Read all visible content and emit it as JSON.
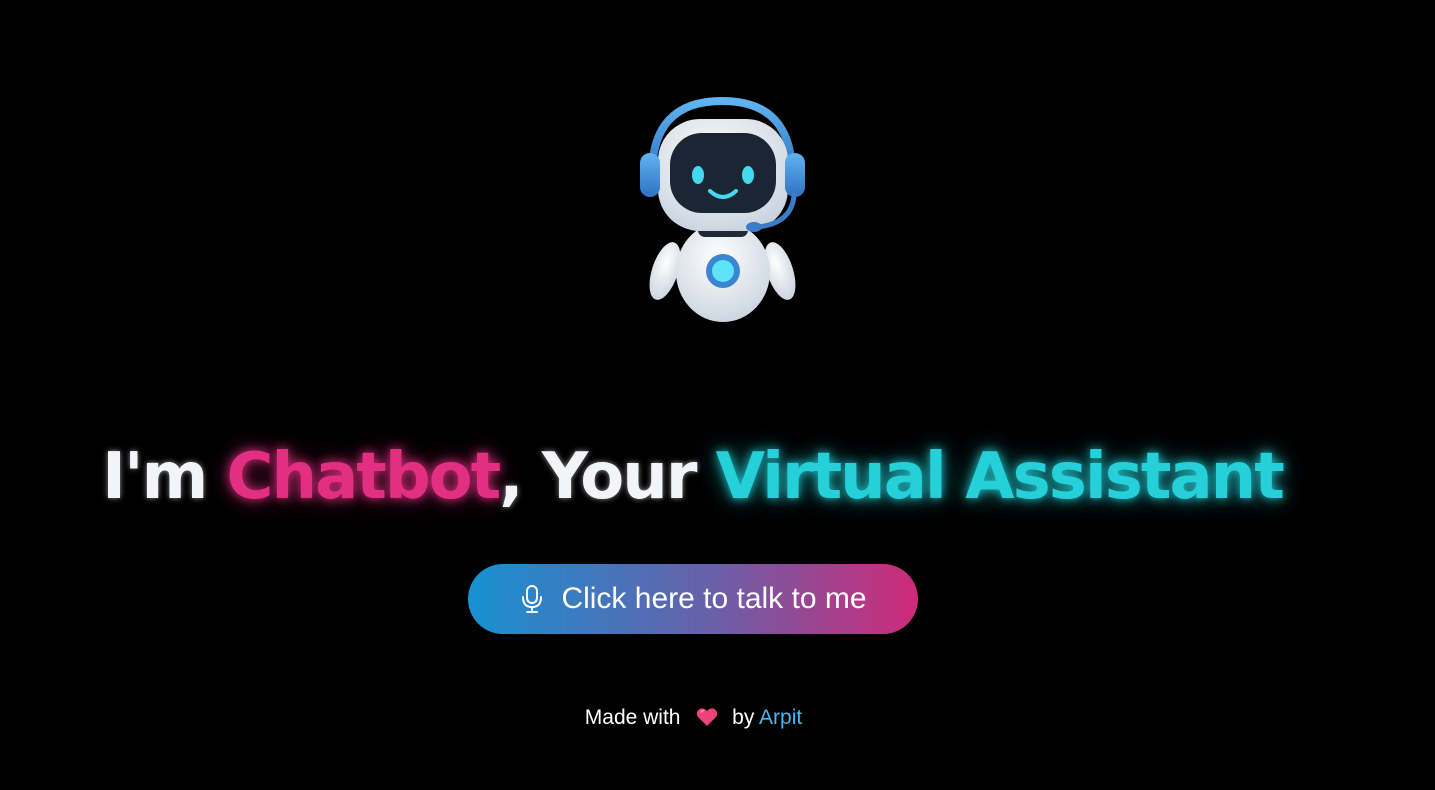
{
  "hero": {
    "robot_image": "robot-assistant-icon"
  },
  "headline": {
    "part1": "I'm ",
    "part2": "Chatbot",
    "part3": ", Your ",
    "part4": "Virtual Assistant"
  },
  "talk_button": {
    "icon": "microphone-icon",
    "label": "Click here to talk to me"
  },
  "footer": {
    "prefix": "Made with",
    "icon": "heart-icon",
    "by": "by",
    "author": "Arpit"
  },
  "colors": {
    "background": "#000000",
    "pink_accent": "#e22f82",
    "cyan_accent": "#25d0d8",
    "button_gradient_start": "#1791d2",
    "button_gradient_end": "#cf2a78",
    "link": "#4ab6ea"
  }
}
